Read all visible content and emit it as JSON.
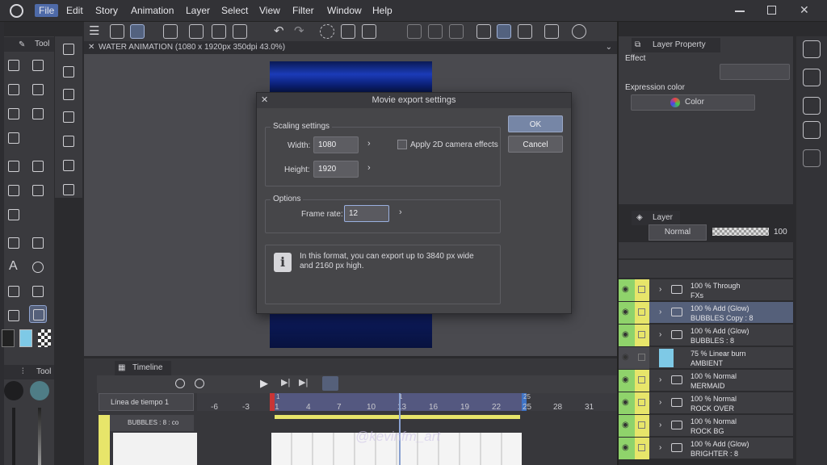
{
  "menubar": {
    "items": [
      "File",
      "Edit",
      "Story",
      "Animation",
      "Layer",
      "Select",
      "View",
      "Filter",
      "Window",
      "Help"
    ],
    "active": "File"
  },
  "document": {
    "tab_title": "WATER ANIMATION (1080 x 1920px 350dpi 43.0%)"
  },
  "tool_panel": {
    "tab": "Tool",
    "sub_tab": "Tool"
  },
  "dialog": {
    "title": "Movie export settings",
    "scaling_group": "Scaling settings",
    "width_label": "Width:",
    "width_value": "1080",
    "height_label": "Height:",
    "height_value": "1920",
    "camera_checkbox_label": "Apply 2D camera effects",
    "options_group": "Options",
    "frame_rate_label": "Frame rate:",
    "frame_rate_value": "12",
    "info_text_line1": "In this format, you can export up to 3840 px wide",
    "info_text_line2": "and 2160 px high.",
    "ok_label": "OK",
    "cancel_label": "Cancel"
  },
  "timeline": {
    "tab": "Timeline",
    "track_name": "Línea de tiempo 1",
    "layer_name": "BUBBLES : 8 : co",
    "ticks": [
      "-6",
      "-3",
      "1",
      "4",
      "7",
      "10",
      "13",
      "16",
      "19",
      "22",
      "25",
      "28",
      "31"
    ],
    "marker_start": "1",
    "marker_mid": "1",
    "marker_end": "25"
  },
  "layer_property": {
    "tab": "Layer Property",
    "effect_label": "Effect",
    "expression_label": "Expression color",
    "expression_value": "Color"
  },
  "layer_panel": {
    "tab": "Layer",
    "blend_mode": "Normal",
    "opacity": "100",
    "layers": [
      {
        "line1": "100 % Through",
        "line2": "FXs"
      },
      {
        "line1": "100 % Add (Glow)",
        "line2": "BUBBLES Copy : 8"
      },
      {
        "line1": "100 % Add (Glow)",
        "line2": "BUBBLES : 8"
      },
      {
        "line1": "75 % Linear burn",
        "line2": "AMBIENT"
      },
      {
        "line1": "100 % Normal",
        "line2": "MERMAID"
      },
      {
        "line1": "100 % Normal",
        "line2": "ROCK OVER"
      },
      {
        "line1": "100 % Normal",
        "line2": "ROCK BG"
      },
      {
        "line1": "100 % Add (Glow)",
        "line2": "BRIGHTER : 8"
      }
    ]
  },
  "watermark": "@kevinfm_art",
  "colors": {
    "accent": "#4e6aa8",
    "eye_column": "#8fd36b",
    "lock_column": "#e7e56a",
    "timeline_marker": "#c93535"
  }
}
